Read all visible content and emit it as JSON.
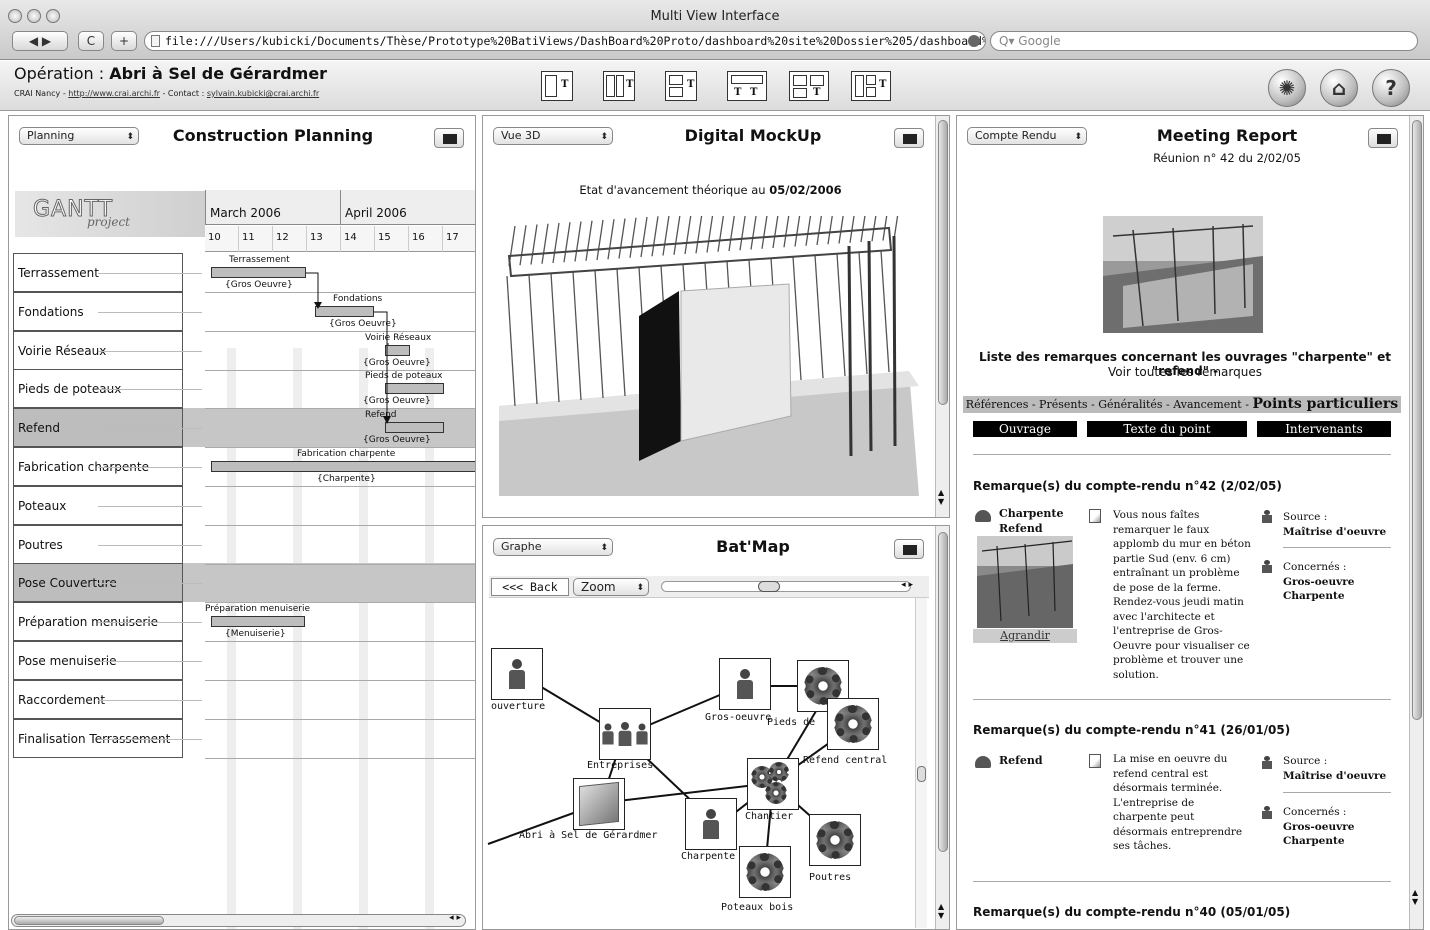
{
  "window": {
    "title": "Multi View Interface",
    "url": "file:///Users/kubicki/Documents/Thèse/Prototype%20BatiViews/DashBoard%20Proto/dashboard%20site%20Dossier%205/dashboard%20",
    "search_placeholder": "Google",
    "back": "◀",
    "forward": "▶",
    "reload": "C",
    "add": "+"
  },
  "header": {
    "op_prefix": "Opération : ",
    "op_name": "Abri à Sel de Gérardmer",
    "sub_prefix": "CRAI Nancy - ",
    "sub_link": "http://www.crai.archi.fr",
    "sub_mid": " - Contact : ",
    "sub_email": "sylvain.kubicki@crai.archi.fr",
    "layout_letter": "T",
    "icons": [
      "gear-icon",
      "home-icon",
      "help-icon"
    ],
    "help_glyph": "?"
  },
  "planning": {
    "view": "Planning",
    "title": "Construction Planning",
    "logo": "GANTT",
    "logo_sub": "project",
    "months": [
      "March 2006",
      "April 2006"
    ],
    "days": [
      "10",
      "11",
      "12",
      "13",
      "14",
      "15",
      "16",
      "17"
    ],
    "tasks": [
      "Terrassement",
      "Fondations",
      "Voirie Réseaux",
      "Pieds de poteaux",
      "Refend",
      "Fabrication charpente",
      "Poteaux",
      "Poutres",
      "Pose Couverture",
      "Préparation menuiserie",
      "Pose menuiserie",
      "Raccordement",
      "Finalisation Terrassement"
    ],
    "bars": [
      {
        "label": "Terrassement",
        "group": "{Gros Oeuvre}"
      },
      {
        "label": "Fondations",
        "group": "{Gros Oeuvre}"
      },
      {
        "label": "Voirie Réseaux",
        "group": "{Gros Oeuvre}"
      },
      {
        "label": "Pieds de poteaux",
        "group": "{Gros Oeuvre}"
      },
      {
        "label": "Refend",
        "group": "{Gros Oeuvre}"
      },
      {
        "label": "Fabrication charpente",
        "group": "{Charpente}"
      },
      {
        "label": "Préparation menuiserie",
        "group": "{Menuiserie}"
      }
    ]
  },
  "mockup": {
    "view": "Vue 3D",
    "title": "Digital MockUp",
    "caption_prefix": "Etat d'avancement théorique au ",
    "caption_date": "05/02/2006"
  },
  "batmap": {
    "view": "Graphe",
    "title": "Bat'Map",
    "back": "<<< Back",
    "zoom": "Zoom",
    "nodes": [
      "ouverture",
      "Entreprises",
      "Gros-oeuvre",
      "Pieds de",
      "Refend central",
      "Chantier",
      "Abri à Sel de Gérardmer",
      "Charpente",
      "Poutres",
      "Poteaux bois"
    ]
  },
  "report": {
    "view": "Compte Rendu",
    "title": "Meeting Report",
    "subtitle": "Réunion n° 42 du 2/02/05",
    "list_title": "Liste des remarques concernant les ouvrages \"charpente\" et \"refend\" -",
    "list_link": "Voir toutes les remarques",
    "nav": "Références - Présents - Généralités - Avancement - ",
    "nav_active": "Points particuliers",
    "cols": [
      "Ouvrage",
      "Texte du point",
      "Intervenants"
    ],
    "remarks": [
      {
        "heading": "Remarque(s) du compte-rendu n°42 (2/02/05)",
        "ouvrage": [
          "Charpente",
          "Refend"
        ],
        "enlarge": "Agrandir",
        "text": "Vous nous faîtes remarquer le faux applomb du mur en béton partie Sud (env. 6 cm) entraînant un problème de pose de la ferme. Rendez-vous jeudi matin avec l'architecte et l'entreprise de Gros-Oeuvre pour visualiser ce problème et trouver une solution.",
        "source_label": "Source :",
        "source": "Maîtrise d'oeuvre",
        "concern_label": "Concernés :",
        "concern": [
          "Gros-oeuvre",
          "Charpente"
        ]
      },
      {
        "heading": "Remarque(s) du compte-rendu n°41 (26/01/05)",
        "ouvrage": [
          "Refend"
        ],
        "text": "La mise en oeuvre du refend central est désormais terminée. L'entreprise de charpente peut désormais entreprendre ses tâches.",
        "source_label": "Source :",
        "source": "Maîtrise d'oeuvre",
        "concern_label": "Concernés :",
        "concern": [
          "Gros-oeuvre",
          "Charpente"
        ]
      },
      {
        "heading": "Remarque(s) du compte-rendu n°40 (05/01/05)"
      }
    ]
  },
  "colors": {
    "chrome": "#d4d4d4",
    "highlight_row": "#c6c6c6",
    "bar": "#bdbdbd",
    "nav_band": "#bbbbbb"
  }
}
